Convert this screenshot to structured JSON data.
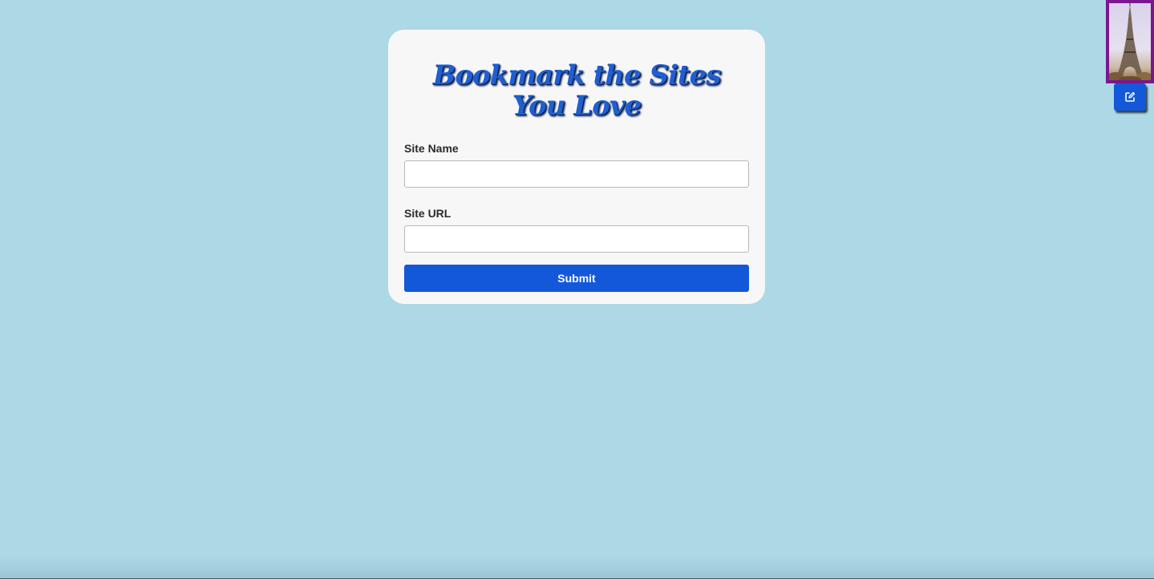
{
  "form": {
    "title": "Bookmark the Sites You Love",
    "site_name_label": "Site Name",
    "site_name_value": "",
    "site_url_label": "Site URL",
    "site_url_value": "",
    "submit_label": "Submit"
  },
  "corner": {
    "image_icon": "eiffel-tower-picture",
    "edit_icon": "edit-icon"
  },
  "colors": {
    "background": "#add8e6",
    "card": "#f8f7f7",
    "accent": "#1358d8",
    "title": "#1f5fd0",
    "thumbnail_border": "#7b1690"
  }
}
